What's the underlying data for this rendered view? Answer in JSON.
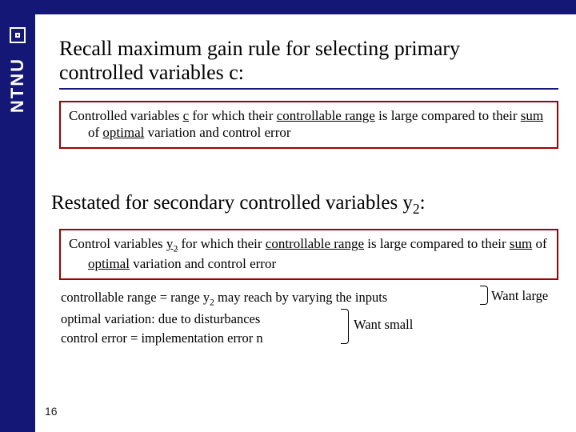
{
  "brand": "NTNU",
  "page_number": "16",
  "title_line1": "Recall maximum gain rule for selecting primary",
  "title_line2": "controlled variables c:",
  "box1_pre": "Controlled variables ",
  "box1_u1": "c",
  "box1_mid1": " for which their ",
  "box1_u2": "controllable range",
  "box1_mid2": " is large compared to their ",
  "box1_u3": "sum",
  "box1_mid3": " of ",
  "box1_u4": "optimal",
  "box1_mid4": " variation and control error",
  "restated_pre": "Restated for secondary controlled variables y",
  "restated_sub": "2",
  "restated_post": ":",
  "box2_pre": "Control variables ",
  "box2_u1a": "y",
  "box2_u1b": "2",
  "box2_mid1": " for which their ",
  "box2_u2": "controllable range",
  "box2_mid2": " is large compared to their ",
  "box2_u3": "sum",
  "box2_mid3": " of ",
  "box2_u4": "optimal",
  "box2_mid4": " variation and control error",
  "def1_pre": "controllable range = range y",
  "def1_sub": "2",
  "def1_post": " may reach by varying the inputs",
  "def2": "optimal variation: due to disturbances",
  "def3": "control error = implementation error n",
  "annot_large": "Want large",
  "annot_small": "Want small"
}
